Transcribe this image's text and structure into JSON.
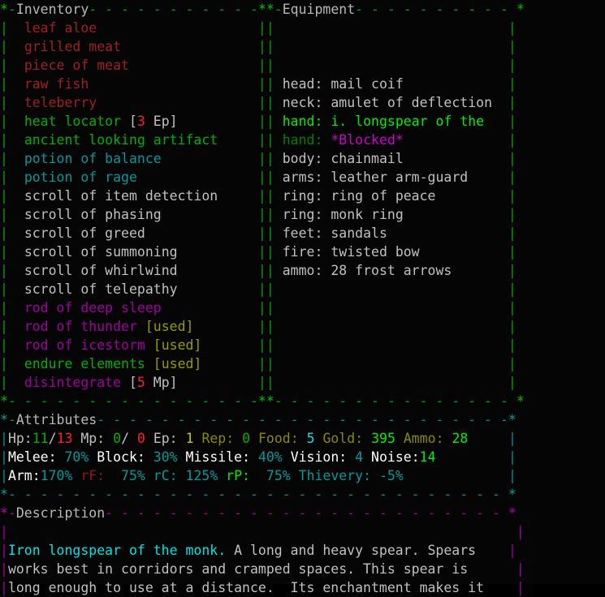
{
  "screen": {
    "cols": 64,
    "rows": 31,
    "background": "#050505"
  },
  "colors": {
    "inventory_border": "#00a000",
    "equipment_border": "#00a000",
    "attributes_border": "#008b8b",
    "description_border": "#9d009d",
    "food_item": "#a02020",
    "evocable": "#00b000",
    "potion": "#009a9a",
    "scroll": "#c0c0c0",
    "rod": "#a000a0",
    "used_tag": "#9a9a00",
    "hp_current": "#00b000",
    "hp_max": "#ff2020",
    "item_name": "#00e5e5"
  },
  "panels": {
    "inventory": {
      "title": "Inventory",
      "corner_left": "*",
      "corner_right": "*",
      "items": [
        {
          "name": "leaf aloe",
          "color": "food",
          "suffix": "",
          "suffix_kind": ""
        },
        {
          "name": "grilled meat",
          "color": "food",
          "suffix": "",
          "suffix_kind": ""
        },
        {
          "name": "piece of meat",
          "color": "food",
          "suffix": "",
          "suffix_kind": ""
        },
        {
          "name": "raw fish",
          "color": "food",
          "suffix": "",
          "suffix_kind": ""
        },
        {
          "name": "teleberry",
          "color": "food",
          "suffix": "",
          "suffix_kind": ""
        },
        {
          "name": "heat locator",
          "color": "evoke",
          "suffix": "[3 Ep]",
          "suffix_kind": "cost",
          "cost_value": "3",
          "cost_unit": "Ep"
        },
        {
          "name": "ancient looking artifact",
          "color": "evoke",
          "suffix": "",
          "suffix_kind": ""
        },
        {
          "name": "potion of balance",
          "color": "potion",
          "suffix": "",
          "suffix_kind": ""
        },
        {
          "name": "potion of rage",
          "color": "potion",
          "suffix": "",
          "suffix_kind": ""
        },
        {
          "name": "scroll of item detection",
          "color": "scroll",
          "suffix": "",
          "suffix_kind": ""
        },
        {
          "name": "scroll of phasing",
          "color": "scroll",
          "suffix": "",
          "suffix_kind": ""
        },
        {
          "name": "scroll of greed",
          "color": "scroll",
          "suffix": "",
          "suffix_kind": ""
        },
        {
          "name": "scroll of summoning",
          "color": "scroll",
          "suffix": "",
          "suffix_kind": ""
        },
        {
          "name": "scroll of whirlwind",
          "color": "scroll",
          "suffix": "",
          "suffix_kind": ""
        },
        {
          "name": "scroll of telepathy",
          "color": "scroll",
          "suffix": "",
          "suffix_kind": ""
        },
        {
          "name": "rod of deep sleep",
          "color": "rod",
          "suffix": "",
          "suffix_kind": ""
        },
        {
          "name": "rod of thunder",
          "color": "rod",
          "suffix": "[used]",
          "suffix_kind": "used"
        },
        {
          "name": "rod of icestorm",
          "color": "rod",
          "suffix": "[used]",
          "suffix_kind": "used"
        },
        {
          "name": "endure elements",
          "color": "evoke",
          "suffix": "[used]",
          "suffix_kind": "used"
        },
        {
          "name": "disintegrate",
          "color": "rod",
          "suffix": "[5 Mp]",
          "suffix_kind": "cost",
          "cost_value": "5",
          "cost_unit": "Mp"
        }
      ]
    },
    "equipment": {
      "title": "Equipment",
      "slots": [
        {
          "slot": "head",
          "value": "mail coif",
          "style": "normal"
        },
        {
          "slot": "neck",
          "value": "amulet of deflection",
          "style": "normal"
        },
        {
          "slot": "hand",
          "value": "i. longspear of the",
          "style": "wielded"
        },
        {
          "slot": "hand",
          "value": "*Blocked*",
          "style": "blocked"
        },
        {
          "slot": "body",
          "value": "chainmail",
          "style": "normal"
        },
        {
          "slot": "arms",
          "value": "leather arm-guard",
          "style": "normal"
        },
        {
          "slot": "ring",
          "value": "ring of peace",
          "style": "normal"
        },
        {
          "slot": "ring",
          "value": "monk ring",
          "style": "normal"
        },
        {
          "slot": "feet",
          "value": "sandals",
          "style": "normal"
        },
        {
          "slot": "fire",
          "value": "twisted bow",
          "style": "normal"
        },
        {
          "slot": "ammo",
          "value": "28 frost arrows",
          "style": "normal"
        }
      ]
    },
    "attributes": {
      "title": "Attributes",
      "row1": {
        "hp_label": "Hp:",
        "hp_current": "11",
        "hp_sep": "/",
        "hp_max": "13",
        "mp_label": "Mp: ",
        "mp_current": "0",
        "mp_sep": "/",
        "mp_max": " 0",
        "ep_label": "Ep: ",
        "ep_value": "1",
        "rep_label": "Rep: ",
        "rep_value": "0",
        "food_label": "Food: ",
        "food_value": "5",
        "gold_label": "Gold: ",
        "gold_value": "395",
        "ammo_label": "Ammo: ",
        "ammo_value": "28"
      },
      "row2": {
        "melee_label": "Melee: ",
        "melee_value": "70%",
        "block_label": "Block: ",
        "block_value": "30%",
        "missile_label": "Missile: ",
        "missile_value": "40%",
        "vision_label": "Vision: ",
        "vision_value": "4",
        "noise_label": "Noise:",
        "noise_value": "14"
      },
      "row3": {
        "arm_label": "Arm:",
        "arm_value": "170%",
        "rf_label": "rF:",
        "rf_value": "  75%",
        "rc_label": "rC:",
        "rc_value": " 125%",
        "rp_label": "rP:",
        "rp_value": "  75%",
        "thievery_label": "Thievery: ",
        "thievery_value": "-5%"
      }
    },
    "description": {
      "title": "Description",
      "item_name": "Iron longspear of the monk.",
      "lines": [
        " A long and heavy spear. Spears",
        "works best in corridors and cramped spaces. This spear is",
        "long enough to use at a distance.  Its enchantment makes it"
      ]
    }
  }
}
